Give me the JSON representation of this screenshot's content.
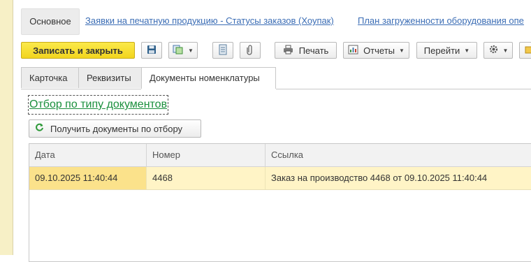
{
  "nav": {
    "main_tab": "Основное",
    "links": [
      "Заявки на печатную продукцию - Статусы заказов (Хоупак)",
      "План загруженности оборудования опе"
    ]
  },
  "toolbar": {
    "save_close": "Записать и закрыть",
    "print": "Печать",
    "reports": "Отчеты",
    "goto": "Перейти"
  },
  "tabs": [
    "Карточка",
    "Реквизиты",
    "Документы номенклатуры"
  ],
  "filter_link": "Отбор по типу документов",
  "get_docs_button": "Получить документы по отбору",
  "table": {
    "columns": [
      "Дата",
      "Номер",
      "Ссылка"
    ],
    "rows": [
      {
        "date": "09.10.2025 11:40:44",
        "number": "4468",
        "ref": "Заказ на производство 4468 от 09.10.2025 11:40:44"
      }
    ]
  },
  "colors": {
    "primary_button": "#f2d51e",
    "link": "#3b6db5",
    "filter_link": "#1a8f3c",
    "row_highlight": "#fff4c6",
    "cell_selected": "#fbe28b"
  },
  "icons": [
    "save-icon",
    "copy-to-icon",
    "list-icon",
    "attach-icon",
    "printer-icon",
    "reports-icon",
    "gear-icon",
    "refresh-icon"
  ]
}
